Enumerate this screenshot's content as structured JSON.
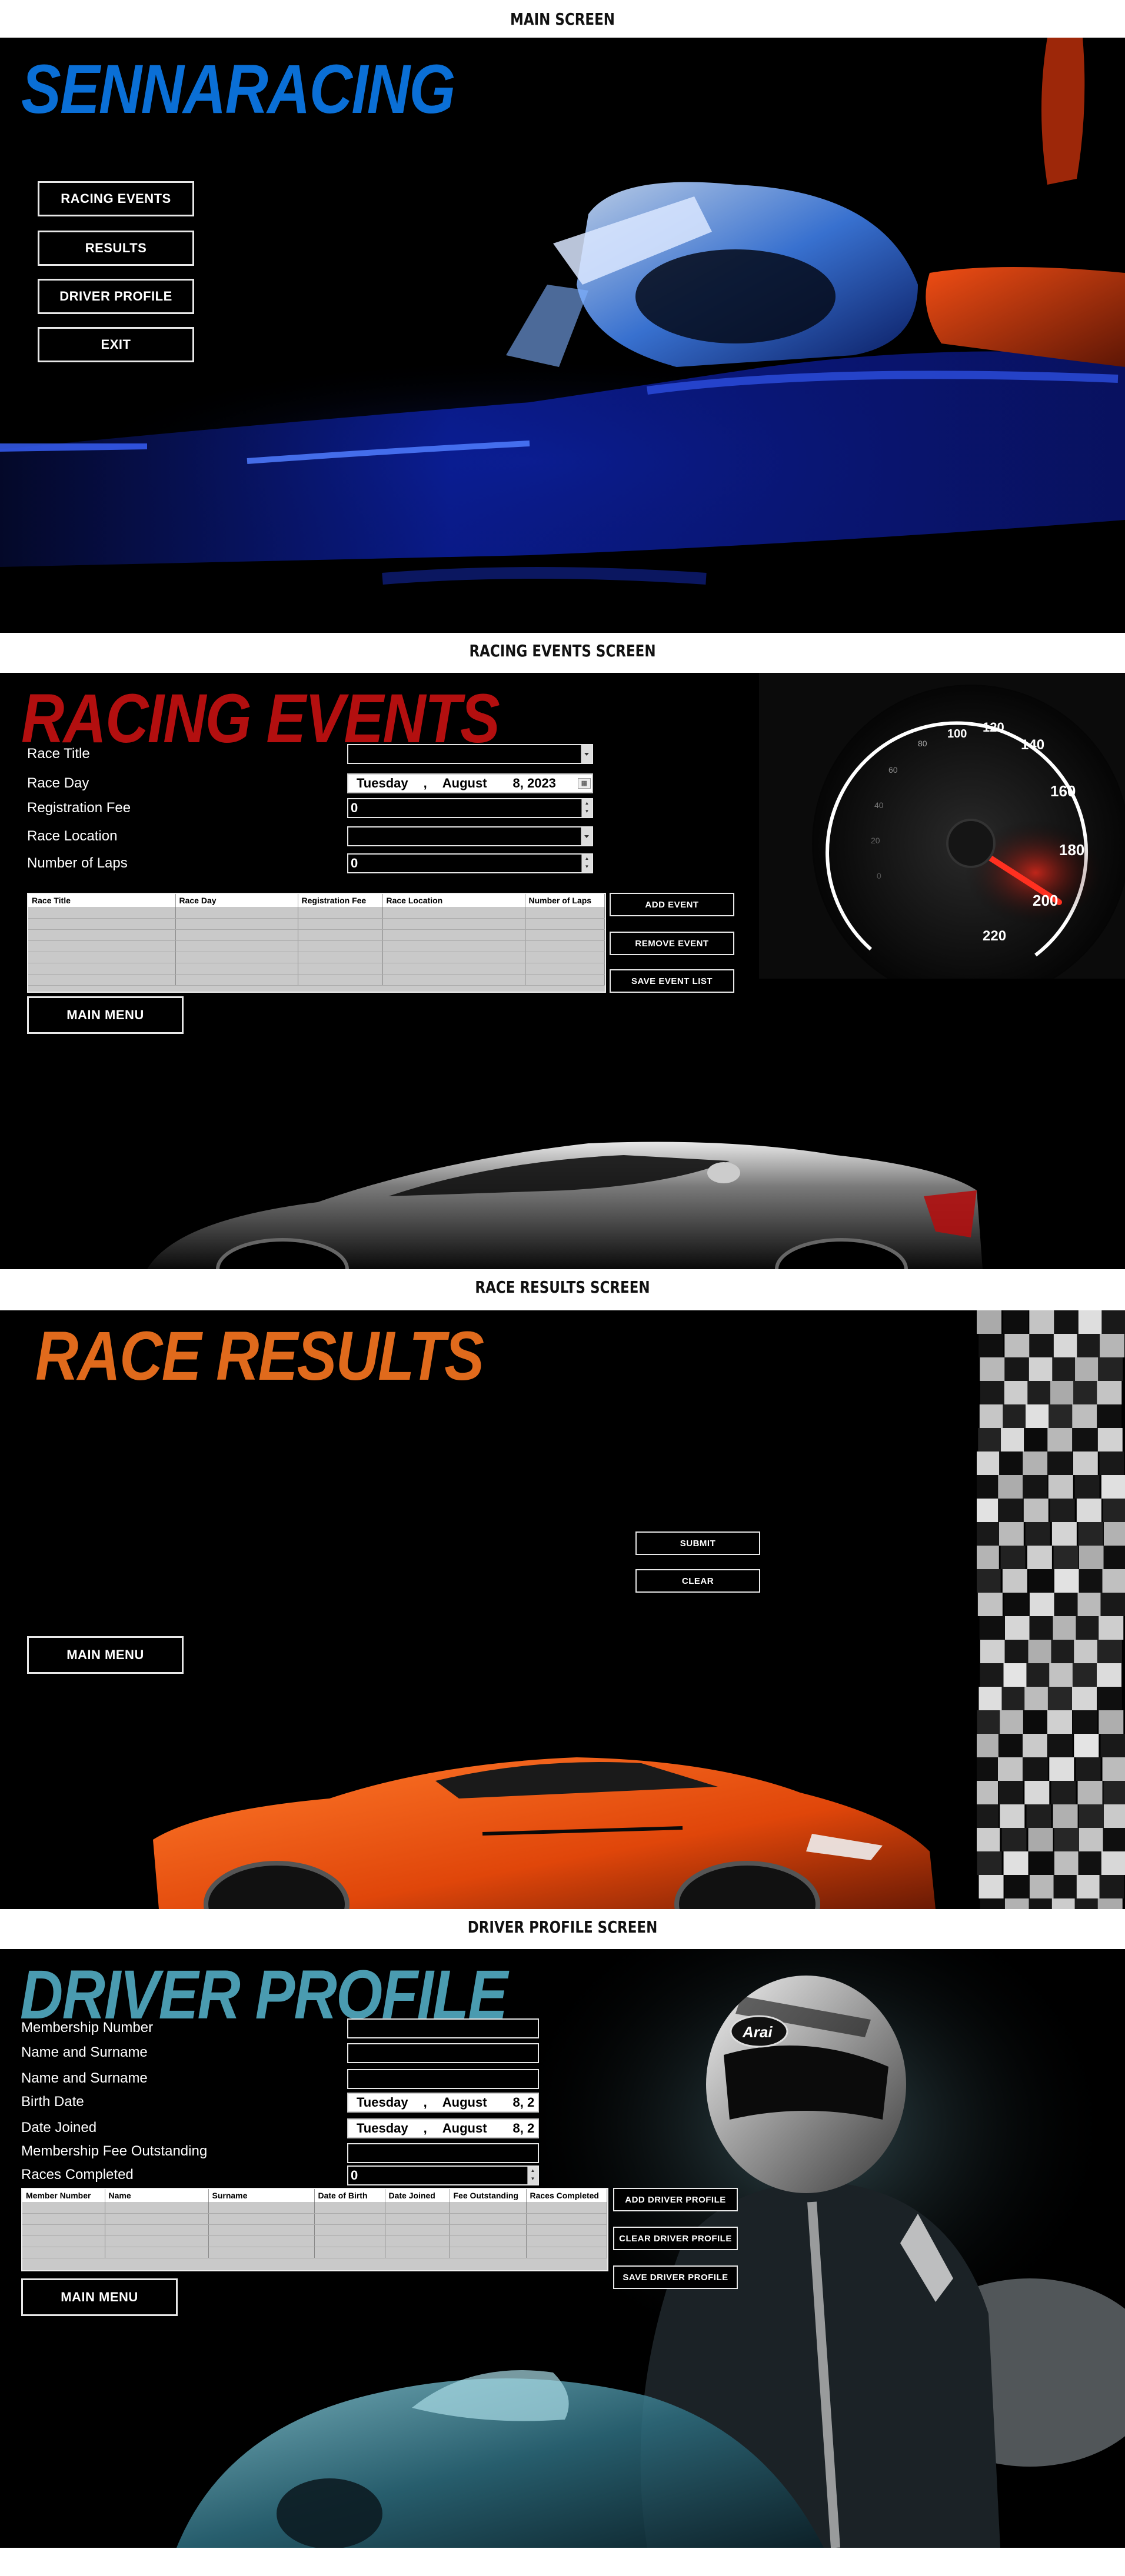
{
  "captions": {
    "main": "MAIN SCREEN",
    "events": "RACING EVENTS SCREEN",
    "results": "RACE RESULTS SCREEN",
    "driver": "DRIVER PROFILE SCREEN"
  },
  "main_screen": {
    "title": "SENNARACING",
    "title_color": "#0a6fd6",
    "buttons": {
      "racing_events": "RACING EVENTS",
      "results": "RESULTS",
      "driver_profile": "DRIVER PROFILE",
      "exit": "EXIT"
    }
  },
  "events_screen": {
    "title": "RACING EVENTS",
    "title_color": "#b30f0f",
    "labels": {
      "race_title": "Race Title",
      "race_day": "Race Day",
      "registration_fee": "Registration Fee",
      "race_location": "Race Location",
      "number_of_laps": "Number of Laps"
    },
    "race_day_value": {
      "weekday": "Tuesday",
      "sep": ",",
      "month": "August",
      "day_year": "8, 2023"
    },
    "registration_fee_value": "0",
    "number_of_laps_value": "0",
    "table_headers": [
      "Race Title",
      "Race Day",
      "Registration Fee",
      "Race Location",
      "Number of Laps"
    ],
    "buttons": {
      "add_event": "ADD EVENT",
      "remove_event": "REMOVE EVENT",
      "save_event_list": "SAVE EVENT LIST",
      "main_menu": "MAIN MENU"
    },
    "gauge_ticks": [
      "100",
      "120",
      "140",
      "160",
      "180",
      "200",
      "220",
      "80",
      "60",
      "40",
      "20",
      "0"
    ]
  },
  "results_screen": {
    "title": "RACE RESULTS",
    "title_color": "#e06a1c",
    "buttons": {
      "submit": "SUBMIT",
      "clear": "CLEAR",
      "main_menu": "MAIN MENU"
    }
  },
  "driver_screen": {
    "title": "DRIVER PROFILE",
    "title_color": "#4a9bb0",
    "labels": {
      "membership_number": "Membership Number",
      "name_and_surname_1": "Name and Surname",
      "name_and_surname_2": "Name and Surname",
      "birth_date": "Birth Date",
      "date_joined": "Date Joined",
      "membership_fee_outstanding": "Membership Fee Outstanding",
      "races_completed": "Races Completed"
    },
    "birth_date_value": {
      "weekday": "Tuesday",
      "sep": ",",
      "month": "August",
      "day_year": "8, 2"
    },
    "date_joined_value": {
      "weekday": "Tuesday",
      "sep": ",",
      "month": "August",
      "day_year": "8, 2"
    },
    "races_completed_value": "0",
    "table_headers": [
      "Member Number",
      "Name",
      "Surname",
      "Date of Birth",
      "Date Joined",
      "Fee Outstanding",
      "Races Completed"
    ],
    "helmet_brand": "Arai",
    "buttons": {
      "add_driver_profile": "ADD DRIVER PROFILE",
      "clear_driver_profile": "CLEAR DRIVER PROFILE",
      "save_driver_profile": "SAVE DRIVER PROFILE",
      "main_menu": "MAIN MENU"
    }
  }
}
